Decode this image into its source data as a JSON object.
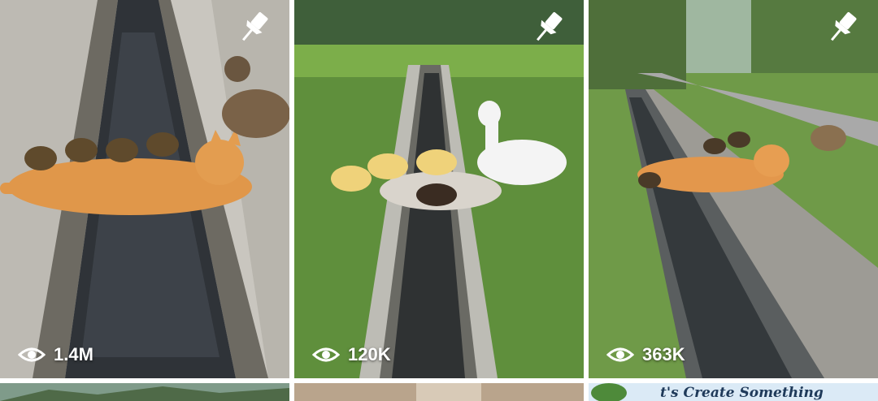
{
  "tiles": [
    {
      "id": "tile-1",
      "views": "1.4M",
      "pin_icon": "pin-icon",
      "views_icon": "eye-icon"
    },
    {
      "id": "tile-2",
      "views": "120K",
      "pin_icon": "pin-icon",
      "views_icon": "eye-icon"
    },
    {
      "id": "tile-3",
      "views": "363K",
      "pin_icon": "pin-icon",
      "views_icon": "eye-icon"
    }
  ],
  "next_row": {
    "caption_partial": "t's Create Something"
  },
  "colors": {
    "overlay_text": "#ffffff",
    "caption": "#1f3a5a"
  }
}
